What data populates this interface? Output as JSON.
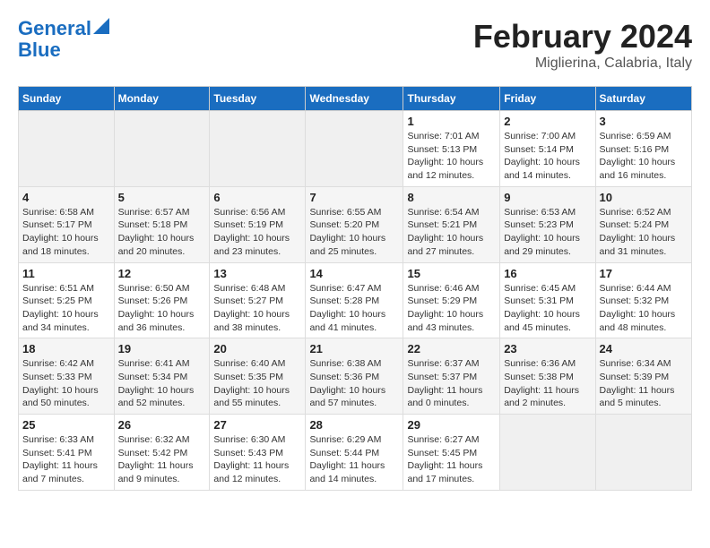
{
  "logo": {
    "line1": "General",
    "line2": "Blue"
  },
  "title": "February 2024",
  "subtitle": "Miglierina, Calabria, Italy",
  "weekdays": [
    "Sunday",
    "Monday",
    "Tuesday",
    "Wednesday",
    "Thursday",
    "Friday",
    "Saturday"
  ],
  "weeks": [
    [
      {
        "day": "",
        "info": ""
      },
      {
        "day": "",
        "info": ""
      },
      {
        "day": "",
        "info": ""
      },
      {
        "day": "",
        "info": ""
      },
      {
        "day": "1",
        "info": "Sunrise: 7:01 AM\nSunset: 5:13 PM\nDaylight: 10 hours\nand 12 minutes."
      },
      {
        "day": "2",
        "info": "Sunrise: 7:00 AM\nSunset: 5:14 PM\nDaylight: 10 hours\nand 14 minutes."
      },
      {
        "day": "3",
        "info": "Sunrise: 6:59 AM\nSunset: 5:16 PM\nDaylight: 10 hours\nand 16 minutes."
      }
    ],
    [
      {
        "day": "4",
        "info": "Sunrise: 6:58 AM\nSunset: 5:17 PM\nDaylight: 10 hours\nand 18 minutes."
      },
      {
        "day": "5",
        "info": "Sunrise: 6:57 AM\nSunset: 5:18 PM\nDaylight: 10 hours\nand 20 minutes."
      },
      {
        "day": "6",
        "info": "Sunrise: 6:56 AM\nSunset: 5:19 PM\nDaylight: 10 hours\nand 23 minutes."
      },
      {
        "day": "7",
        "info": "Sunrise: 6:55 AM\nSunset: 5:20 PM\nDaylight: 10 hours\nand 25 minutes."
      },
      {
        "day": "8",
        "info": "Sunrise: 6:54 AM\nSunset: 5:21 PM\nDaylight: 10 hours\nand 27 minutes."
      },
      {
        "day": "9",
        "info": "Sunrise: 6:53 AM\nSunset: 5:23 PM\nDaylight: 10 hours\nand 29 minutes."
      },
      {
        "day": "10",
        "info": "Sunrise: 6:52 AM\nSunset: 5:24 PM\nDaylight: 10 hours\nand 31 minutes."
      }
    ],
    [
      {
        "day": "11",
        "info": "Sunrise: 6:51 AM\nSunset: 5:25 PM\nDaylight: 10 hours\nand 34 minutes."
      },
      {
        "day": "12",
        "info": "Sunrise: 6:50 AM\nSunset: 5:26 PM\nDaylight: 10 hours\nand 36 minutes."
      },
      {
        "day": "13",
        "info": "Sunrise: 6:48 AM\nSunset: 5:27 PM\nDaylight: 10 hours\nand 38 minutes."
      },
      {
        "day": "14",
        "info": "Sunrise: 6:47 AM\nSunset: 5:28 PM\nDaylight: 10 hours\nand 41 minutes."
      },
      {
        "day": "15",
        "info": "Sunrise: 6:46 AM\nSunset: 5:29 PM\nDaylight: 10 hours\nand 43 minutes."
      },
      {
        "day": "16",
        "info": "Sunrise: 6:45 AM\nSunset: 5:31 PM\nDaylight: 10 hours\nand 45 minutes."
      },
      {
        "day": "17",
        "info": "Sunrise: 6:44 AM\nSunset: 5:32 PM\nDaylight: 10 hours\nand 48 minutes."
      }
    ],
    [
      {
        "day": "18",
        "info": "Sunrise: 6:42 AM\nSunset: 5:33 PM\nDaylight: 10 hours\nand 50 minutes."
      },
      {
        "day": "19",
        "info": "Sunrise: 6:41 AM\nSunset: 5:34 PM\nDaylight: 10 hours\nand 52 minutes."
      },
      {
        "day": "20",
        "info": "Sunrise: 6:40 AM\nSunset: 5:35 PM\nDaylight: 10 hours\nand 55 minutes."
      },
      {
        "day": "21",
        "info": "Sunrise: 6:38 AM\nSunset: 5:36 PM\nDaylight: 10 hours\nand 57 minutes."
      },
      {
        "day": "22",
        "info": "Sunrise: 6:37 AM\nSunset: 5:37 PM\nDaylight: 11 hours\nand 0 minutes."
      },
      {
        "day": "23",
        "info": "Sunrise: 6:36 AM\nSunset: 5:38 PM\nDaylight: 11 hours\nand 2 minutes."
      },
      {
        "day": "24",
        "info": "Sunrise: 6:34 AM\nSunset: 5:39 PM\nDaylight: 11 hours\nand 5 minutes."
      }
    ],
    [
      {
        "day": "25",
        "info": "Sunrise: 6:33 AM\nSunset: 5:41 PM\nDaylight: 11 hours\nand 7 minutes."
      },
      {
        "day": "26",
        "info": "Sunrise: 6:32 AM\nSunset: 5:42 PM\nDaylight: 11 hours\nand 9 minutes."
      },
      {
        "day": "27",
        "info": "Sunrise: 6:30 AM\nSunset: 5:43 PM\nDaylight: 11 hours\nand 12 minutes."
      },
      {
        "day": "28",
        "info": "Sunrise: 6:29 AM\nSunset: 5:44 PM\nDaylight: 11 hours\nand 14 minutes."
      },
      {
        "day": "29",
        "info": "Sunrise: 6:27 AM\nSunset: 5:45 PM\nDaylight: 11 hours\nand 17 minutes."
      },
      {
        "day": "",
        "info": ""
      },
      {
        "day": "",
        "info": ""
      }
    ]
  ]
}
